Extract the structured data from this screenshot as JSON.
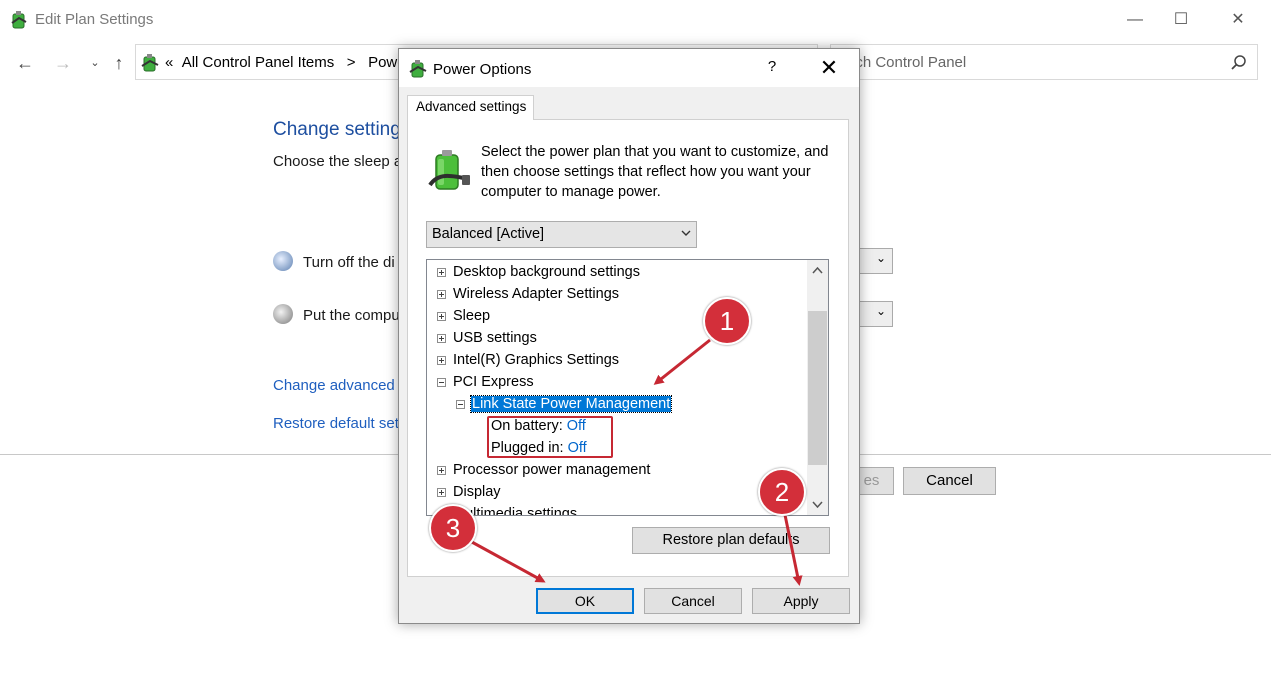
{
  "window": {
    "title": "Edit Plan Settings",
    "controls": {
      "minimize": "—",
      "maximize": "☐",
      "close": "✕"
    },
    "breadcrumb_prefix": "«",
    "breadcrumb": [
      "All Control Panel Items",
      "Power"
    ],
    "breadcrumb_sep": ">",
    "search_placeholder": "arch Control Panel"
  },
  "background": {
    "heading": "Change setting",
    "subtext": "Choose the sleep a",
    "rows": [
      {
        "label": "Turn off the di"
      },
      {
        "label": "Put the compu"
      }
    ],
    "links": [
      "Change advanced p",
      "Restore default set"
    ],
    "save_button": "es",
    "cancel_button": "Cancel"
  },
  "dialog": {
    "title": "Power Options",
    "help": "?",
    "close": "✕",
    "tab": "Advanced settings",
    "intro": "Select the power plan that you want to customize, and then choose settings that reflect how you want your computer to manage power.",
    "plan_selected": "Balanced [Active]",
    "tree": {
      "desktop_bg": "Desktop background settings",
      "wireless": "Wireless Adapter Settings",
      "sleep": "Sleep",
      "usb": "USB settings",
      "intel": "Intel(R) Graphics Settings",
      "pci": "PCI Express",
      "lspm": "Link State Power Management",
      "on_battery_label": "On battery:",
      "on_battery_value": "Off",
      "plugged_in_label": "Plugged in:",
      "plugged_in_value": "Off",
      "processor": "Processor power management",
      "display": "Display",
      "multimedia": "Multimedia settings"
    },
    "restore_defaults": "Restore plan defaults",
    "ok": "OK",
    "cancel": "Cancel",
    "apply": "Apply"
  },
  "annotations": {
    "badge_1": "1",
    "badge_2": "2",
    "badge_3": "3",
    "color": "#d32f3a"
  }
}
